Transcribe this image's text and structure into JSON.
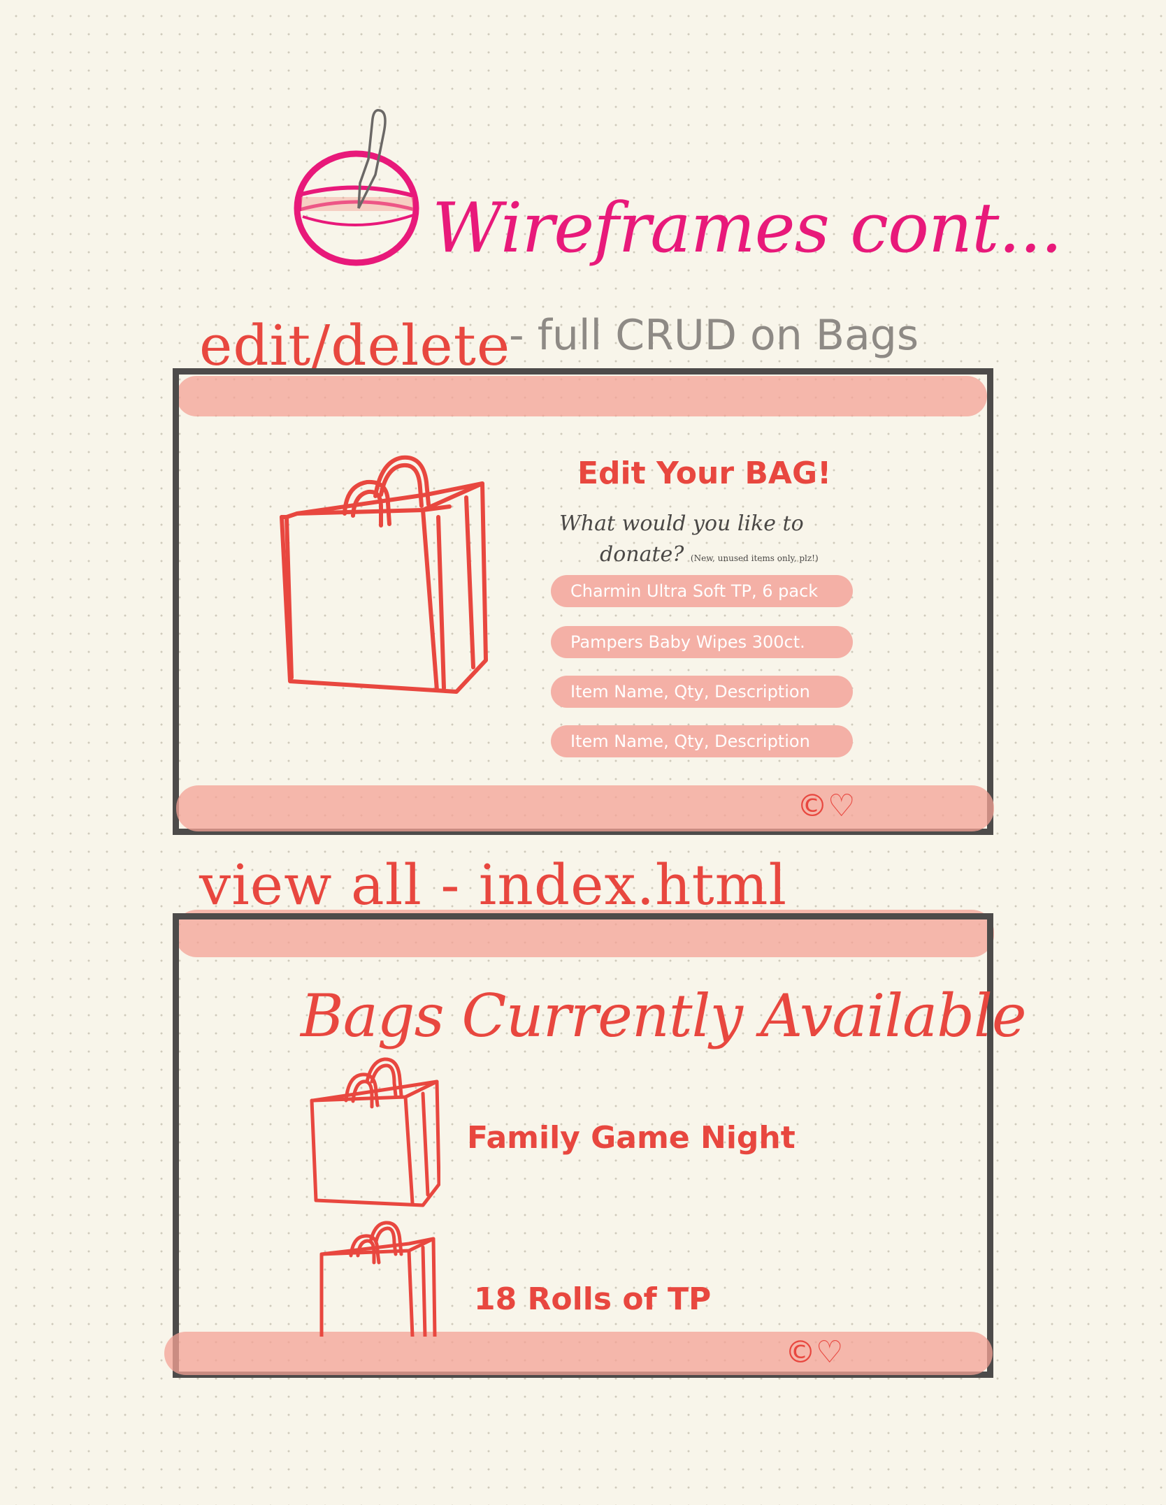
{
  "header": {
    "title": "Wireframes cont..."
  },
  "edit_section": {
    "label": "edit/delete",
    "sub_label": "- full CRUD on Bags",
    "form": {
      "title": "Edit Your BAG!",
      "question_line1": "What would you like to",
      "question_line2": "donate?",
      "question_note": "(New, unused items only, plz!)",
      "fields": [
        "Charmin Ultra Soft TP, 6 pack",
        "Pampers Baby Wipes 300ct.",
        "Item Name, Qty, Description",
        "Item Name, Qty, Description"
      ]
    },
    "footer_icons": "©♡"
  },
  "view_section": {
    "label": "view all - index.html",
    "title": "Bags Currently Available",
    "bags": [
      {
        "name": "Family Game Night"
      },
      {
        "name": "18 Rolls of TP"
      }
    ],
    "footer_icons": "©♡"
  },
  "colors": {
    "header_pink": "#e8197a",
    "accent_red": "#e8473f",
    "bar_pink": "#f4a195",
    "frame_gray": "#4d4b4a",
    "paper": "#f8f5ea"
  }
}
